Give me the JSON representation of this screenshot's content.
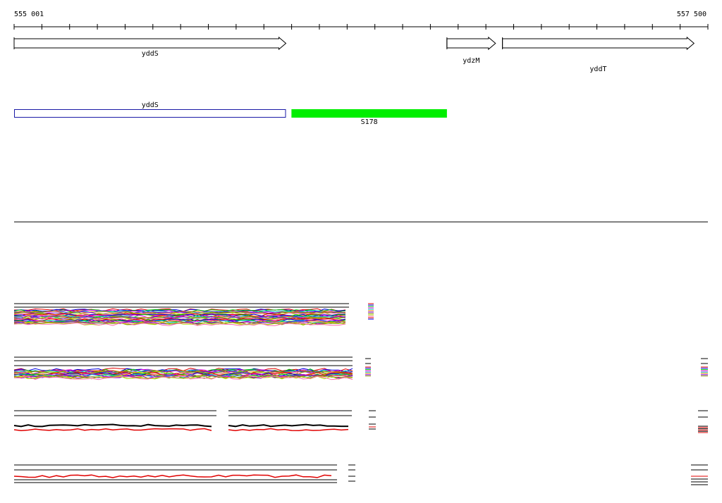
{
  "ruler": {
    "start_label": "555 001",
    "end_label": "557 500",
    "start": 555001,
    "end": 557500
  },
  "genes": [
    {
      "name": "yddS",
      "start": 555001,
      "end": 555980,
      "strand": "+",
      "label_row": 0
    },
    {
      "name": "ydzM",
      "start": 556560,
      "end": 556735,
      "strand": "+",
      "label_row": 1
    },
    {
      "name": "yddT",
      "start": 556760,
      "end": 557450,
      "strand": "+",
      "label_row": 2
    }
  ],
  "regions": [
    {
      "name": "yddS",
      "start": 555001,
      "end": 555980,
      "color": "#1a1aa6",
      "filled": false,
      "label_above": true
    },
    {
      "name": "S178",
      "start": 556000,
      "end": 556560,
      "color": "#00ee00",
      "filled": true,
      "label_above": false
    }
  ],
  "colors": {
    "axis": "#000000",
    "gene_outline": "#000000",
    "region_outline": "#1a1aa6",
    "region_fill": "#00ee00",
    "trace_primary": "#e00000",
    "trace_secondary": "#000000"
  },
  "trace_palette": [
    "#e00000",
    "#0000e0",
    "#00c000",
    "#e000e0",
    "#00c0c0",
    "#e08000",
    "#8000e0",
    "#808000",
    "#aadd00",
    "#ff66aa"
  ]
}
